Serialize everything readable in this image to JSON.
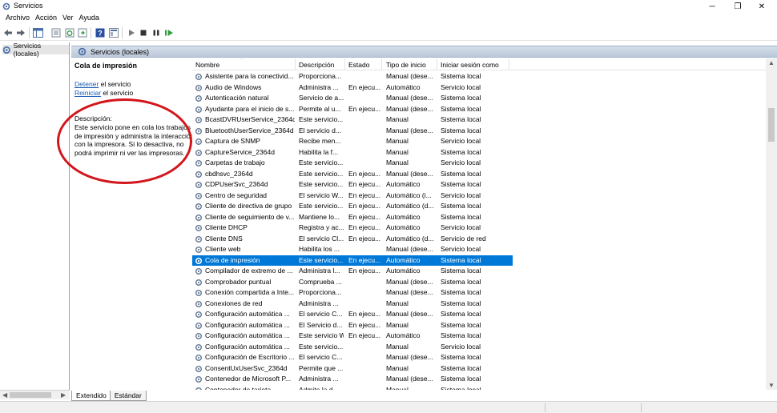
{
  "window": {
    "title": "Servicios",
    "minimize": "─",
    "maximize": "❐",
    "close": "✕"
  },
  "menu": [
    "Archivo",
    "Acción",
    "Ver",
    "Ayuda"
  ],
  "toolbar": {
    "icons": [
      "back-arrow-icon",
      "forward-arrow-icon",
      "console-tree-icon",
      "properties-icon",
      "refresh-icon",
      "export-list-icon",
      "help-icon",
      "view-icon",
      "play-icon",
      "stop-icon",
      "pause-icon",
      "restart-icon"
    ]
  },
  "tree": {
    "label": "Servicios (locales)"
  },
  "pane": {
    "header": "Servicios (locales)"
  },
  "detail": {
    "title": "Cola de impresión",
    "stop_link": "Detener",
    "stop_suffix": " el servicio",
    "restart_link": "Reiniciar",
    "restart_suffix": " el servicio",
    "desc_label": "Descripción:",
    "desc_text": "Este servicio pone en cola los trabajos de impresión y administra la interacción con la impresora. Si lo desactiva, no podrá imprimir ni ver las impresoras."
  },
  "columns": {
    "name": "Nombre",
    "description": "Descripción",
    "status": "Estado",
    "startup": "Tipo de inicio",
    "logon": "Iniciar sesión como"
  },
  "services": [
    [
      "Asistente para la conectivid...",
      "Proporciona...",
      "",
      "Manual (dese...",
      "Sistema local"
    ],
    [
      "Audio de Windows",
      "Administra ...",
      "En ejecu...",
      "Automático",
      "Servicio local"
    ],
    [
      "Autenticación natural",
      "Servicio de a...",
      "",
      "Manual (dese...",
      "Sistema local"
    ],
    [
      "Ayudante para el inicio de s...",
      "Permite al u...",
      "En ejecu...",
      "Manual (dese...",
      "Sistema local"
    ],
    [
      "BcastDVRUserService_2364d",
      "Este servicio...",
      "",
      "Manual",
      "Sistema local"
    ],
    [
      "BluetoothUserService_2364d",
      "El servicio d...",
      "",
      "Manual (dese...",
      "Sistema local"
    ],
    [
      "Captura de SNMP",
      "Recibe men...",
      "",
      "Manual",
      "Servicio local"
    ],
    [
      "CaptureService_2364d",
      "Habilita la f...",
      "",
      "Manual",
      "Sistema local"
    ],
    [
      "Carpetas de trabajo",
      "Este servicio...",
      "",
      "Manual",
      "Servicio local"
    ],
    [
      "cbdhsvc_2364d",
      "Este servicio...",
      "En ejecu...",
      "Manual (dese...",
      "Sistema local"
    ],
    [
      "CDPUserSvc_2364d",
      "Este servicio...",
      "En ejecu...",
      "Automático",
      "Sistema local"
    ],
    [
      "Centro de seguridad",
      "El servicio W...",
      "En ejecu...",
      "Automático (i...",
      "Servicio local"
    ],
    [
      "Cliente de directiva de grupo",
      "Este servicio...",
      "En ejecu...",
      "Automático (d...",
      "Sistema local"
    ],
    [
      "Cliente de seguimiento de v...",
      "Mantiene lo...",
      "En ejecu...",
      "Automático",
      "Sistema local"
    ],
    [
      "Cliente DHCP",
      "Registra y ac...",
      "En ejecu...",
      "Automático",
      "Servicio local"
    ],
    [
      "Cliente DNS",
      "El servicio Cl...",
      "En ejecu...",
      "Automático (d...",
      "Servicio de red"
    ],
    [
      "Cliente web",
      "Habilita los ...",
      "",
      "Manual (dese...",
      "Servicio local"
    ],
    [
      "Cola de impresión",
      "Este servicio...",
      "En ejecu...",
      "Automático",
      "Sistema local"
    ],
    [
      "Compilador de extremo de ...",
      "Administra l...",
      "En ejecu...",
      "Automático",
      "Sistema local"
    ],
    [
      "Comprobador puntual",
      "Comprueba ...",
      "",
      "Manual (dese...",
      "Sistema local"
    ],
    [
      "Conexión compartida a Inte...",
      "Proporciona...",
      "",
      "Manual (dese...",
      "Sistema local"
    ],
    [
      "Conexiones de red",
      "Administra ...",
      "",
      "Manual",
      "Sistema local"
    ],
    [
      "Configuración automática ...",
      "El servicio C...",
      "En ejecu...",
      "Manual (dese...",
      "Sistema local"
    ],
    [
      "Configuración automática ...",
      "El Servicio d...",
      "En ejecu...",
      "Manual",
      "Sistema local"
    ],
    [
      "Configuración automática ...",
      "Este servicio W...",
      "En ejecu...",
      "Automático",
      "Sistema local"
    ],
    [
      "Configuración automática ...",
      "Este servicio...",
      "",
      "Manual",
      "Servicio local"
    ],
    [
      "Configuración de Escritorio ...",
      "El servicio C...",
      "",
      "Manual (dese...",
      "Sistema local"
    ],
    [
      "ConsentUxUserSvc_2364d",
      "Permite que ...",
      "",
      "Manual",
      "Sistema local"
    ],
    [
      "Contenedor de Microsoft P...",
      "Administra ...",
      "",
      "Manual (dese...",
      "Sistema local"
    ],
    [
      "Contenedor de tarjeta...",
      "Admite la d...",
      "",
      "Manual",
      "Sistema local"
    ]
  ],
  "selected_index": 17,
  "tabs": [
    "Extendido",
    "Estándar"
  ]
}
